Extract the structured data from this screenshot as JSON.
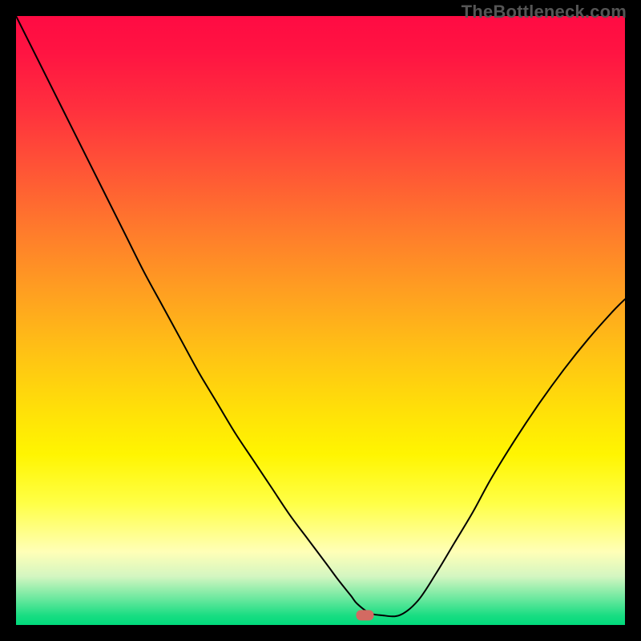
{
  "watermark": "TheBottleneck.com",
  "chart_data": {
    "type": "line",
    "title": "",
    "xlabel": "",
    "ylabel": "",
    "xlim": [
      0,
      100
    ],
    "ylim": [
      0,
      100
    ],
    "grid": false,
    "legend": false,
    "background_gradient": [
      {
        "pos": 0.0,
        "color": "#ff0b43"
      },
      {
        "pos": 0.06,
        "color": "#ff1442"
      },
      {
        "pos": 0.15,
        "color": "#ff2f3e"
      },
      {
        "pos": 0.25,
        "color": "#ff5436"
      },
      {
        "pos": 0.35,
        "color": "#ff7a2c"
      },
      {
        "pos": 0.45,
        "color": "#ff9e21"
      },
      {
        "pos": 0.55,
        "color": "#ffc115"
      },
      {
        "pos": 0.65,
        "color": "#ffe108"
      },
      {
        "pos": 0.72,
        "color": "#fff501"
      },
      {
        "pos": 0.8,
        "color": "#ffff46"
      },
      {
        "pos": 0.88,
        "color": "#ffffb7"
      },
      {
        "pos": 0.92,
        "color": "#d4f6c1"
      },
      {
        "pos": 0.955,
        "color": "#70e9a0"
      },
      {
        "pos": 0.985,
        "color": "#18dd82"
      },
      {
        "pos": 1.0,
        "color": "#00da7b"
      }
    ],
    "series": [
      {
        "name": "bottleneck-curve",
        "color": "#000000",
        "x": [
          0,
          3,
          6,
          9,
          12,
          15,
          18,
          21,
          24,
          27,
          30,
          33,
          36,
          39,
          42,
          45,
          48,
          51,
          53,
          55,
          56,
          58,
          60,
          63,
          66,
          69,
          72,
          75,
          78,
          82,
          86,
          90,
          94,
          98,
          100
        ],
        "y": [
          100,
          94,
          88,
          82,
          76,
          70,
          64,
          58,
          52.5,
          47,
          41.5,
          36.5,
          31.5,
          27,
          22.5,
          18,
          14,
          10,
          7.3,
          4.8,
          3.5,
          2,
          1.6,
          1.6,
          4,
          8.5,
          13.5,
          18.5,
          24,
          30.5,
          36.5,
          42,
          47,
          51.5,
          53.5
        ]
      }
    ],
    "marker": {
      "name": "optimal-marker",
      "x": 57.3,
      "y": 1.6,
      "color": "#d36a62",
      "shape": "rounded-rect"
    }
  }
}
